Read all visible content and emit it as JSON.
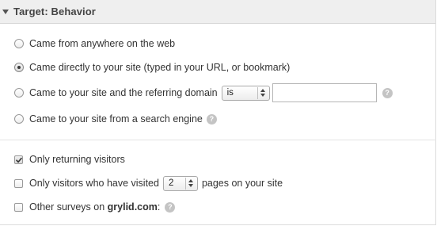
{
  "header": {
    "title": "Target: Behavior"
  },
  "source_options": [
    {
      "label": "Came from anywhere on the web",
      "checked": false
    },
    {
      "label": "Came directly to your site (typed in your URL, or bookmark)",
      "checked": true
    },
    {
      "label": "Came to your site and the referring domain",
      "checked": false
    },
    {
      "label": "Came to your site from a search engine",
      "checked": false
    }
  ],
  "referring_domain": {
    "operator": "is",
    "value": ""
  },
  "returning_visitors": {
    "label": "Only returning visitors",
    "checked": true
  },
  "pages_visited": {
    "label_before": "Only visitors who have visited",
    "count": "2",
    "label_after": "pages on your site",
    "checked": false
  },
  "other_surveys": {
    "label_prefix": "Other surveys on ",
    "domain": "grylid.com",
    "label_suffix": ":",
    "checked": false
  },
  "help_icon_glyph": "?",
  "colors": {
    "header_bg": "#efefef",
    "help_icon": "#c4c4c4"
  }
}
